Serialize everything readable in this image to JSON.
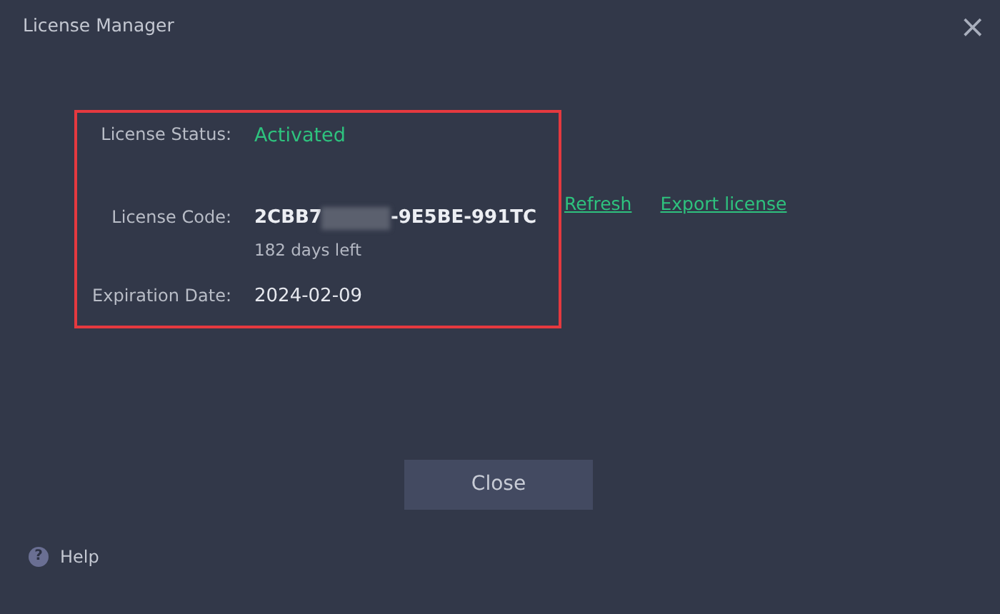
{
  "window": {
    "title": "License Manager",
    "close_glyph": "×"
  },
  "fields": [
    {
      "kind": "status",
      "label": "License Status:",
      "value": "Activated"
    },
    {
      "kind": "code",
      "label": "License Code:",
      "value_before": "2CBB7",
      "value_after": "-9E5BE-991TC",
      "note": "182 days left"
    },
    {
      "kind": "plain",
      "label": "Expiration Date:",
      "value": "2024-02-09"
    }
  ],
  "links": [
    "Refresh",
    "Export license"
  ],
  "buttons": [
    "Close"
  ],
  "help": {
    "glyph": "?",
    "label": "Help"
  }
}
